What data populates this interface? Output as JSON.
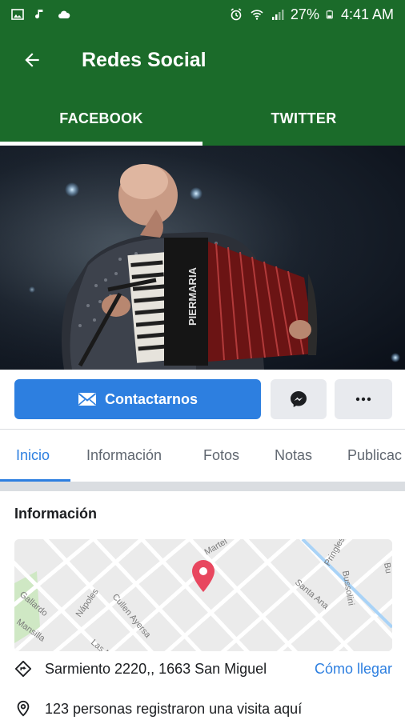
{
  "status_bar": {
    "battery": "27%",
    "time": "4:41 AM",
    "icons": [
      "image-icon",
      "music-note-icon",
      "cloud-icon",
      "alarm-icon",
      "wifi-icon",
      "signal-icon",
      "battery-icon"
    ]
  },
  "app_bar": {
    "title": "Redes Social",
    "back_icon": "arrow-left-icon"
  },
  "tabs": [
    {
      "label": "FACEBOOK",
      "active": true
    },
    {
      "label": "TWITTER",
      "active": false
    }
  ],
  "page_actions": {
    "contact_label": "Contactarnos",
    "messenger_icon": "messenger-icon",
    "more_icon": "more-horizontal-icon"
  },
  "page_tabs": [
    {
      "label": "Inicio",
      "active": true
    },
    {
      "label": "Información",
      "active": false
    },
    {
      "label": "Fotos",
      "active": false
    },
    {
      "label": "Notas",
      "active": false
    },
    {
      "label": "Publicac",
      "active": false
    }
  ],
  "info": {
    "heading": "Información",
    "address": "Sarmiento 2220,, 1663 San Miguel",
    "directions_label": "Cómo llegar",
    "checkins": "123 personas registraron una visita aquí",
    "map_streets": [
      "Gallardo",
      "Nápoles",
      "Cullen Ayersa",
      "Mansilla",
      "Las Malvinas",
      "Santa Ana",
      "Bussolini",
      "Pringles",
      "Martel",
      "Bu"
    ]
  },
  "colors": {
    "app_green": "#1b6b2a",
    "facebook_blue": "#2d7fe0",
    "map_pin": "#e8475f"
  }
}
